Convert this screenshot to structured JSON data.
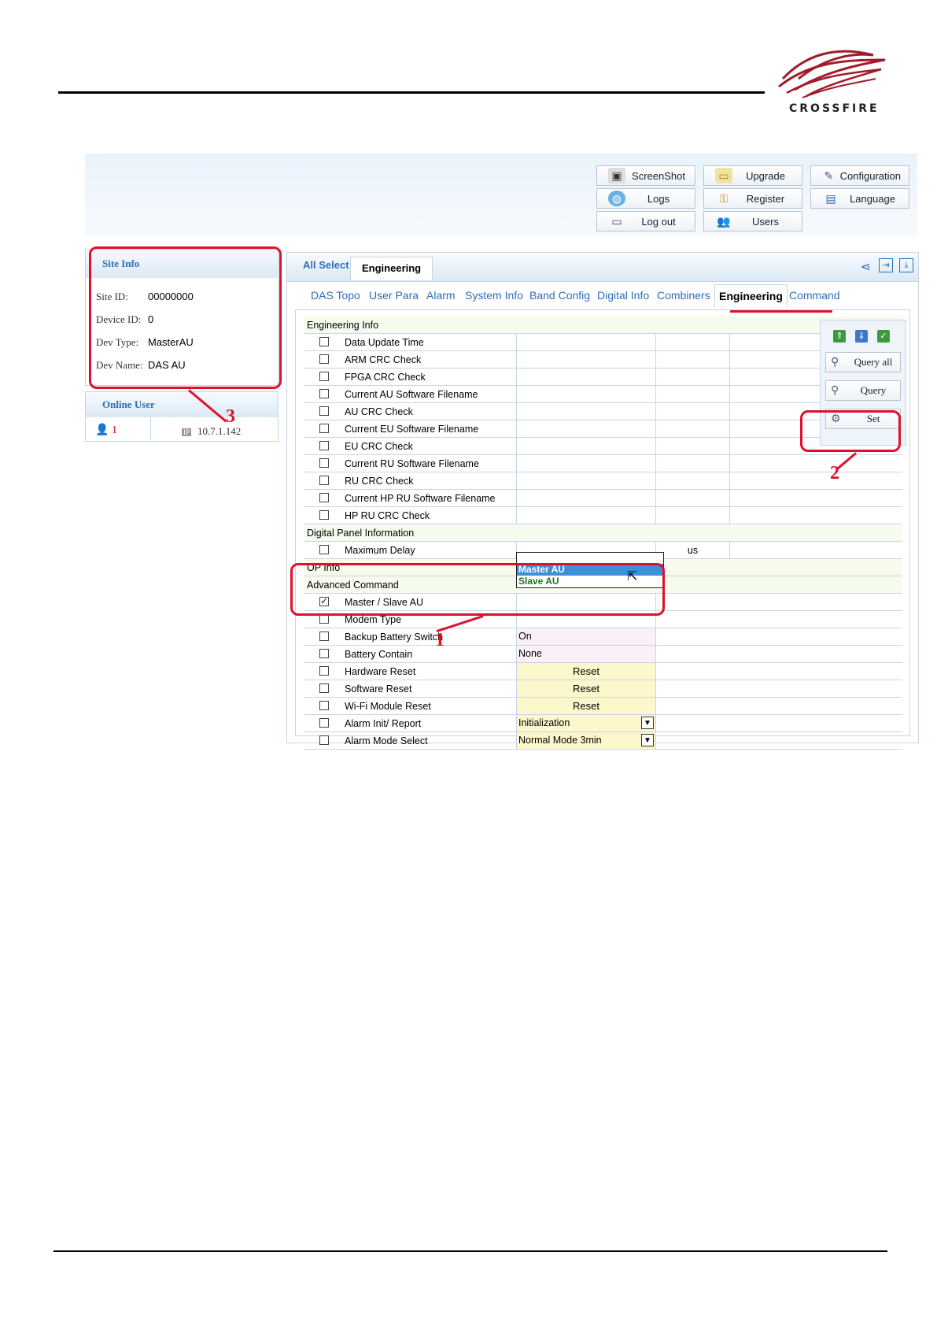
{
  "brand": {
    "name": "CROSSFIRE"
  },
  "toolbar": {
    "buttons": [
      {
        "label": "ScreenShot",
        "icon": "camera-icon"
      },
      {
        "label": "Upgrade",
        "icon": "folder-icon"
      },
      {
        "label": "Configuration",
        "icon": "tools-icon"
      },
      {
        "label": "Logs",
        "icon": "globe-icon"
      },
      {
        "label": "Register",
        "icon": "key-icon"
      },
      {
        "label": "Language",
        "icon": "language-icon"
      },
      {
        "label": "Log out",
        "icon": "computer-icon"
      },
      {
        "label": "Users",
        "icon": "users-icon"
      }
    ]
  },
  "site_info": {
    "title": "Site Info",
    "rows": [
      {
        "key": "Site ID:",
        "value": "00000000"
      },
      {
        "key": "Device ID:",
        "value": "0"
      },
      {
        "key": "Dev Type:",
        "value": "MasterAU"
      },
      {
        "key": "Dev Name:",
        "value": "DAS AU"
      }
    ]
  },
  "online_user": {
    "title": "Online User",
    "count": "1",
    "ip": "10.7.1.142"
  },
  "main_tabs": {
    "all_select": "All Select",
    "engineering": "Engineering"
  },
  "sub_tabs": [
    "DAS Topo",
    "User Para",
    "Alarm",
    "System Info",
    "Band Config",
    "Digital Info",
    "Combiners",
    "Engineering",
    "Command"
  ],
  "sections": {
    "engineering_info": "Engineering Info",
    "digital_panel": "Digital Panel Information",
    "op_info": "OP Info",
    "advanced_command": "Advanced Command"
  },
  "engineering_rows": [
    "Data Update Time",
    "ARM CRC Check",
    "FPGA CRC Check",
    "Current AU Software Filename",
    "AU CRC Check",
    "Current EU Software Filename",
    "EU CRC Check",
    "Current RU Software Filename",
    "RU CRC Check",
    "Current HP RU Software Filename",
    "HP RU CRC Check"
  ],
  "digital_rows": [
    {
      "name": "Maximum Delay",
      "unit": "us"
    }
  ],
  "advanced_rows": [
    {
      "name": "Master / Slave AU",
      "checked": "✓",
      "value": ""
    },
    {
      "name": "Modem Type",
      "checked": "",
      "value": ""
    },
    {
      "name": "Backup Battery Switch",
      "checked": "",
      "value": "On"
    },
    {
      "name": "Battery Contain",
      "checked": "",
      "value": "None"
    },
    {
      "name": "Hardware Reset",
      "checked": "",
      "value": "Reset"
    },
    {
      "name": "Software Reset",
      "checked": "",
      "value": "Reset"
    },
    {
      "name": "Wi-Fi Module Reset",
      "checked": "",
      "value": "Reset"
    },
    {
      "name": "Alarm Init/ Report",
      "checked": "",
      "value": "Initialization"
    },
    {
      "name": "Alarm Mode Select",
      "checked": "",
      "value": "Normal Mode 3min"
    }
  ],
  "dropdown_options": [
    "Master AU",
    "Slave AU"
  ],
  "side_buttons": {
    "query_all": "Query all",
    "query": "Query",
    "set": "Set"
  },
  "annotations": [
    "1",
    "2",
    "3"
  ],
  "colors": {
    "accent": "#2c6fb8",
    "annotation_red": "#e0102a",
    "selected_option": "#3e8fd8",
    "slave_option": "#1a7a1a"
  }
}
